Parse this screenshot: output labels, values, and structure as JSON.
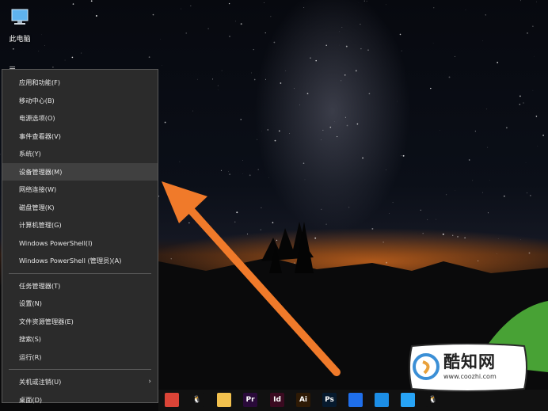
{
  "desktop": {
    "icon_label": "此电脑"
  },
  "menu": {
    "items": [
      {
        "label": "应用和功能(F)"
      },
      {
        "label": "移动中心(B)"
      },
      {
        "label": "电源选项(O)"
      },
      {
        "label": "事件查看器(V)"
      },
      {
        "label": "系统(Y)"
      },
      {
        "label": "设备管理器(M)",
        "highlighted": true
      },
      {
        "label": "网络连接(W)"
      },
      {
        "label": "磁盘管理(K)"
      },
      {
        "label": "计算机管理(G)"
      },
      {
        "label": "Windows PowerShell(I)"
      },
      {
        "label": "Windows PowerShell (管理员)(A)"
      },
      {
        "label": "任务管理器(T)"
      },
      {
        "label": "设置(N)"
      },
      {
        "label": "文件资源管理器(E)"
      },
      {
        "label": "搜索(S)"
      },
      {
        "label": "运行(R)"
      },
      {
        "label": "关机或注销(U)",
        "submenu": true
      },
      {
        "label": "桌面(D)"
      }
    ],
    "submenu_glyph": "›"
  },
  "taskbar": {
    "icons": [
      {
        "name": "chrome-icon",
        "color": "#db4437",
        "text": ""
      },
      {
        "name": "qq-icon",
        "color": "#111111",
        "text": "🐧"
      },
      {
        "name": "file-explorer-icon",
        "color": "#f2c14e",
        "text": ""
      },
      {
        "name": "premiere-icon",
        "color": "#2a0a3a",
        "text": "Pr"
      },
      {
        "name": "indesign-icon",
        "color": "#3a0a20",
        "text": "Id"
      },
      {
        "name": "illustrator-icon",
        "color": "#2e1a05",
        "text": "Ai"
      },
      {
        "name": "photoshop-icon",
        "color": "#061a2e",
        "text": "Ps"
      },
      {
        "name": "security-shield-icon",
        "color": "#1f6feb",
        "text": ""
      },
      {
        "name": "bird-app-icon",
        "color": "#1c8ee6",
        "text": ""
      },
      {
        "name": "feather-app-icon",
        "color": "#27a3f5",
        "text": ""
      },
      {
        "name": "penguin-app-icon",
        "color": "#111111",
        "text": "🐧"
      }
    ]
  },
  "watermark": {
    "title": "酷知网",
    "url": "www.coozhi.com"
  },
  "colors": {
    "arrow": "#f07a2a",
    "menu_bg": "#2b2b2b",
    "menu_highlight": "#404040"
  }
}
